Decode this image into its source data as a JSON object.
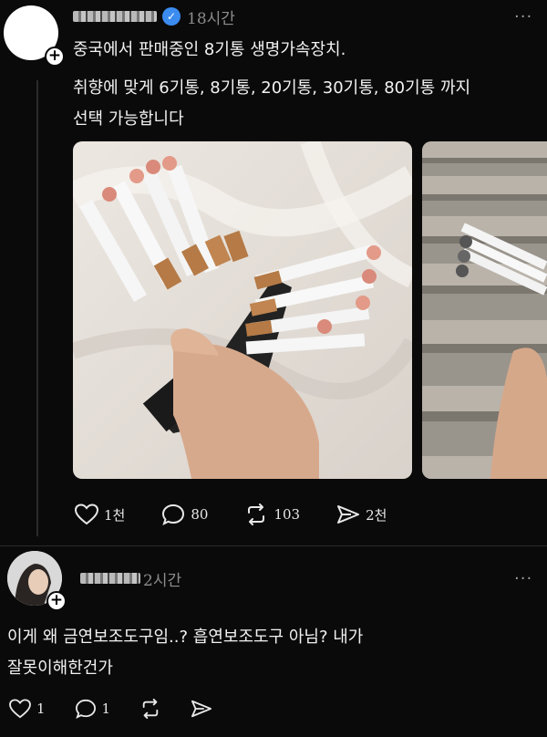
{
  "post1": {
    "time": "18시간",
    "more": "···",
    "title": "중국에서 판매중인 8기통 생명가속장치.",
    "body_line1": "취향에 맞게 6기통, 8기통, 20기통, 30기통, 80기통 까지",
    "body_line2": "선택 가능합니다",
    "likes": "1천",
    "comments": "80",
    "reposts": "103",
    "shares": "2천"
  },
  "post2": {
    "time": "2시간",
    "more": "···",
    "body_line1": "이게 왜 금연보조도구임..? 흡연보조도구 아님? 내가",
    "body_line2": "잘못이해한건가",
    "likes": "1",
    "comments": "1"
  },
  "colors": {
    "background": "#0a0a0a",
    "text": "#f2f2f2",
    "muted": "#8c8c8c",
    "verified": "#3c8cf0"
  }
}
